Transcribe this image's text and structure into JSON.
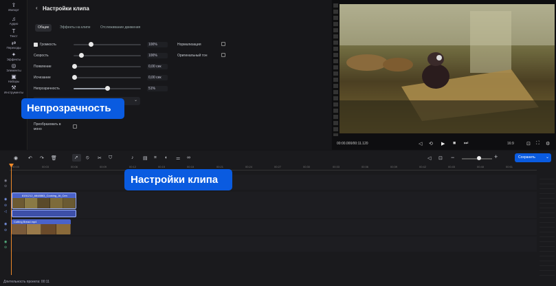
{
  "sidebar": {
    "items": [
      {
        "label": "Импорт",
        "icon": "import-icon"
      },
      {
        "label": "Аудио",
        "icon": "music-note-icon"
      },
      {
        "label": "Текст",
        "icon": "text-icon"
      },
      {
        "label": "Переходы",
        "icon": "transitions-icon"
      },
      {
        "label": "Эффекты",
        "icon": "effects-icon"
      },
      {
        "label": "Элементы",
        "icon": "elements-icon"
      },
      {
        "label": "Наборы",
        "icon": "sets-icon"
      },
      {
        "label": "Инструменты",
        "icon": "tools-icon"
      }
    ]
  },
  "panel": {
    "title": "Настройки клипа",
    "tabs": [
      "Общие",
      "Эффекты на клипе",
      "Отслеживание движения"
    ],
    "rows": [
      {
        "label": "Громкость",
        "value": "100%",
        "level": 0.27,
        "checkbox": true
      },
      {
        "label": "Скорость",
        "value": "100%",
        "level": 0.12
      },
      {
        "label": "Появление",
        "value": "0,00 сек",
        "level": 0
      },
      {
        "label": "Исчезание",
        "value": "0,00 сек",
        "level": 0
      },
      {
        "label": "Непрозрачность",
        "value": "51%",
        "level": 0.51
      }
    ],
    "normalization": "Нормализация",
    "original_tone": "Оригинальный тон",
    "convert_mono": [
      "Преобразовать в",
      "моно"
    ]
  },
  "callouts": {
    "opacity": "Непрозрачность",
    "clip_settings": "Настройки клипа"
  },
  "player": {
    "time": "00:00.000/00:11.120",
    "aspect": "16:9"
  },
  "toolbar": {
    "save_label": "Сохранить"
  },
  "timeline": {
    "ticks": [
      "00:00",
      "00:03",
      "00:06",
      "00:09",
      "00:12",
      "00:15",
      "00:18",
      "00:21",
      "00:24",
      "00:27",
      "00:30",
      "00:33",
      "00:36",
      "00:39",
      "00:42",
      "00:45",
      "00:48",
      "00:51",
      "00:54",
      "00:57",
      "01:00",
      "01:03",
      "01:06"
    ],
    "clip1": "8151212_6848863_Cooking_At_Cen",
    "clip2": "Cutting Bread.mp4"
  },
  "status": {
    "duration": "Длительность проекта: 00:11"
  },
  "colors": {
    "accent": "#0a5be0",
    "clip": "#4a62c9"
  }
}
